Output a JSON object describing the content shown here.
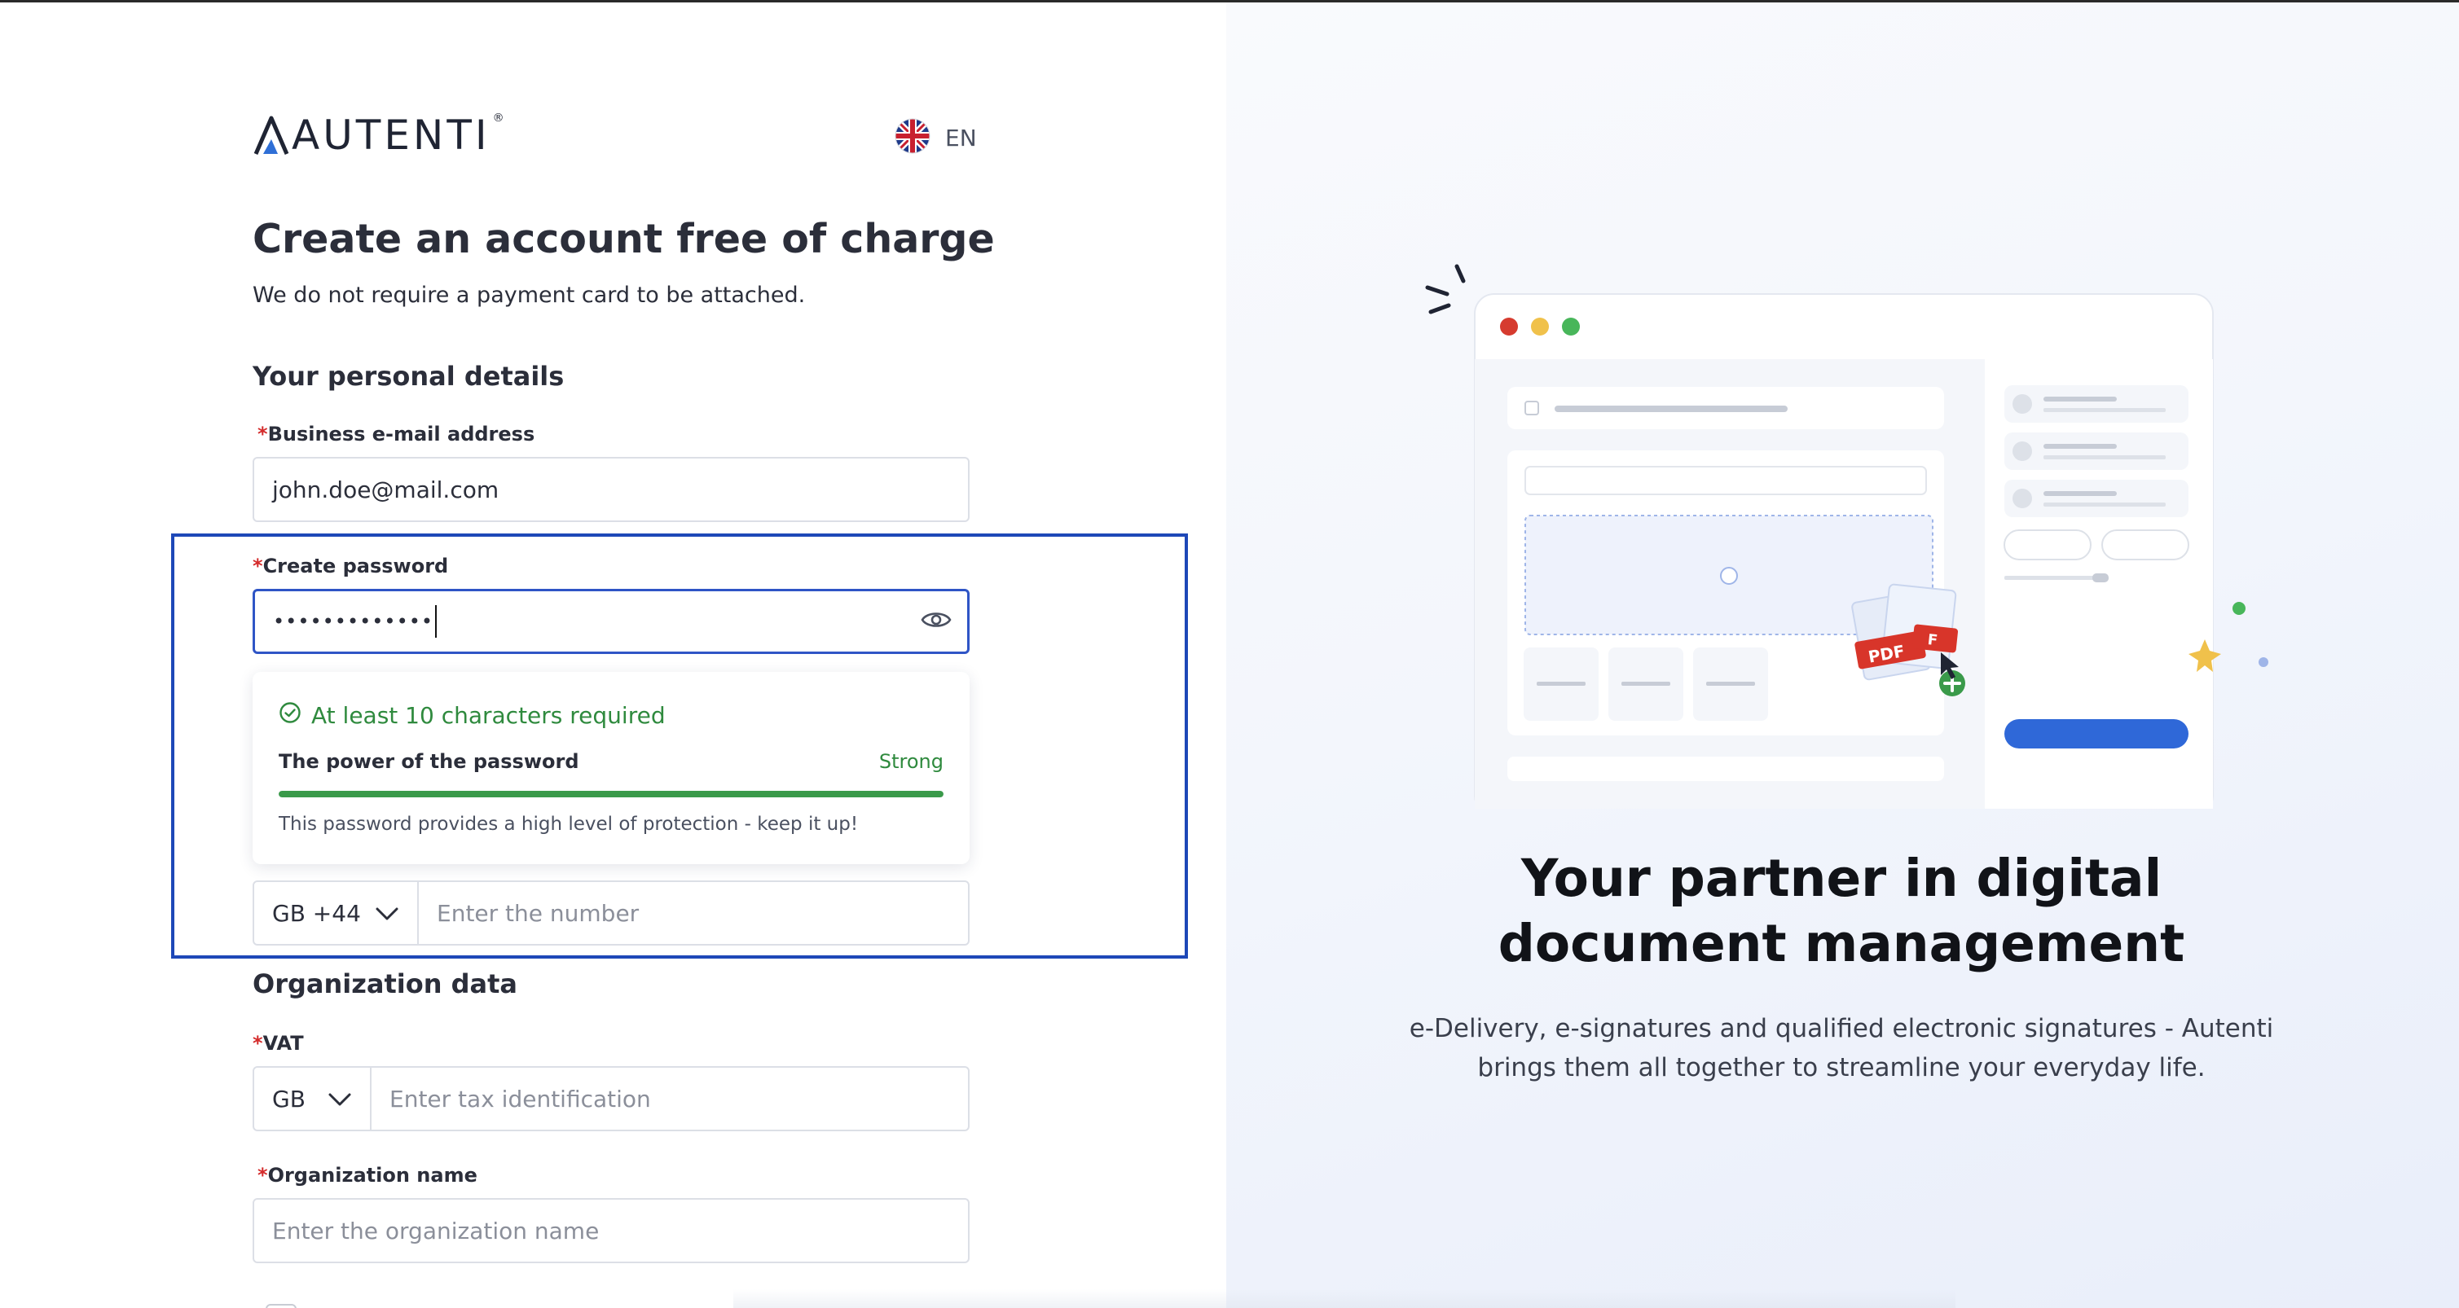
{
  "brand": {
    "logo_text": "AUTENTI",
    "logo_reg": "®"
  },
  "language": {
    "label": "EN",
    "flag_icon": "uk-flag-icon"
  },
  "form": {
    "title": "Create an account free of charge",
    "subtitle": "We do not require a payment card to be attached.",
    "personal_section": "Your personal details",
    "required_mark": "*",
    "email": {
      "label": "Business e-mail address",
      "value": "john.doe@mail.com"
    },
    "password": {
      "label": "Create password",
      "masked_value": "•••••••••••••",
      "toggle_icon": "eye-icon"
    },
    "password_popover": {
      "requirement": "At least 10 characters required",
      "requirement_icon": "check-circle-icon",
      "power_label": "The power of the password",
      "strength": "Strong",
      "strength_fraction": 1.0,
      "hint": "This password provides a high level of protection - keep it up!"
    },
    "phone": {
      "country_code": "GB +44",
      "placeholder": "Enter the number"
    },
    "organization_section": "Organization data",
    "vat": {
      "label": "VAT",
      "country": "GB",
      "placeholder": "Enter tax identification"
    },
    "org_name": {
      "label": "Organization name",
      "placeholder": "Enter the organization name"
    }
  },
  "hero": {
    "title": "Your partner in digital document management",
    "text": "e-Delivery, e-signatures and qualified electronic signatures - Autenti brings them all together to streamline your everyday life.",
    "pdf_label": "PDF",
    "file_label": "F"
  },
  "colors": {
    "accent_blue": "#2f55c6",
    "highlight_border": "#1e48b8",
    "success_green": "#2f8a3e",
    "required_red": "#d42b2b"
  }
}
